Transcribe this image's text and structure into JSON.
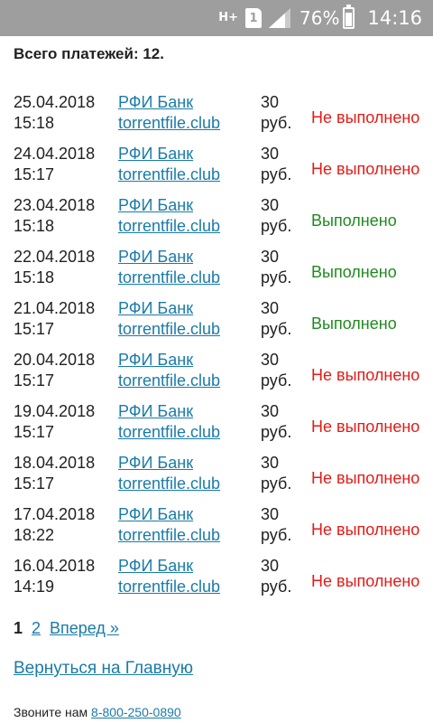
{
  "status_bar": {
    "network_type": "H+",
    "sim_slot": "1",
    "battery_percent": "76%",
    "battery_level": 0.76,
    "time": "14:16"
  },
  "summary": "Всего платежей: 12.",
  "payments": [
    {
      "date": "25.04.2018",
      "time": "15:18",
      "payee_line1": "РФИ Банк",
      "payee_line2": "torrentfile.club",
      "amount": "30",
      "currency": "руб.",
      "status": "Не выполнено",
      "success": false
    },
    {
      "date": "24.04.2018",
      "time": "15:17",
      "payee_line1": "РФИ Банк",
      "payee_line2": "torrentfile.club",
      "amount": "30",
      "currency": "руб.",
      "status": "Не выполнено",
      "success": false
    },
    {
      "date": "23.04.2018",
      "time": "15:18",
      "payee_line1": "РФИ Банк",
      "payee_line2": "torrentfile.club",
      "amount": "30",
      "currency": "руб.",
      "status": "Выполнено",
      "success": true
    },
    {
      "date": "22.04.2018",
      "time": "15:18",
      "payee_line1": "РФИ Банк",
      "payee_line2": "torrentfile.club",
      "amount": "30",
      "currency": "руб.",
      "status": "Выполнено",
      "success": true
    },
    {
      "date": "21.04.2018",
      "time": "15:17",
      "payee_line1": "РФИ Банк",
      "payee_line2": "torrentfile.club",
      "amount": "30",
      "currency": "руб.",
      "status": "Выполнено",
      "success": true
    },
    {
      "date": "20.04.2018",
      "time": "15:17",
      "payee_line1": "РФИ Банк",
      "payee_line2": "torrentfile.club",
      "amount": "30",
      "currency": "руб.",
      "status": "Не выполнено",
      "success": false
    },
    {
      "date": "19.04.2018",
      "time": "15:17",
      "payee_line1": "РФИ Банк",
      "payee_line2": "torrentfile.club",
      "amount": "30",
      "currency": "руб.",
      "status": "Не выполнено",
      "success": false
    },
    {
      "date": "18.04.2018",
      "time": "15:17",
      "payee_line1": "РФИ Банк",
      "payee_line2": "torrentfile.club",
      "amount": "30",
      "currency": "руб.",
      "status": "Не выполнено",
      "success": false
    },
    {
      "date": "17.04.2018",
      "time": "18:22",
      "payee_line1": "РФИ Банк",
      "payee_line2": "torrentfile.club",
      "amount": "30",
      "currency": "руб.",
      "status": "Не выполнено",
      "success": false
    },
    {
      "date": "16.04.2018",
      "time": "14:19",
      "payee_line1": "РФИ Банк",
      "payee_line2": "torrentfile.club",
      "amount": "30",
      "currency": "руб.",
      "status": "Не выполнено",
      "success": false
    }
  ],
  "pagination": {
    "current": "1",
    "pages": [
      "2"
    ],
    "next_label": "Вперед »"
  },
  "back_link": "Вернуться на Главную",
  "footer": {
    "call_label": "Звоните нам",
    "phone": "8-800-250-0890"
  },
  "colors": {
    "link": "#1a7ba8",
    "status_fail": "#e41b17",
    "status_ok": "#1f8a1f",
    "status_bar": "#9e9e9e"
  }
}
